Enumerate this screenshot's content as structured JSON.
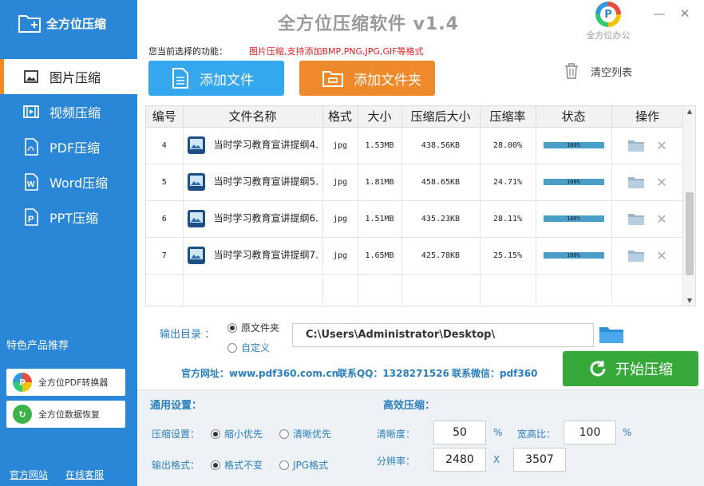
{
  "app": {
    "logo_text": "全方位压缩",
    "title": "全方位压缩软件 v1.4",
    "brand_text": "全方位办公",
    "brand_letter": "P"
  },
  "sidebar": {
    "items": [
      {
        "label": "图片压缩",
        "icon": "image-icon"
      },
      {
        "label": "视频压缩",
        "icon": "film-icon"
      },
      {
        "label": "PDF压缩",
        "icon": "pdf-icon"
      },
      {
        "label": "Word压缩",
        "icon": "word-icon"
      },
      {
        "label": "PPT压缩",
        "icon": "ppt-icon"
      }
    ],
    "promo_title": "特色产品推荐",
    "promo_buttons": [
      "全方位PDF转换器",
      "全方位数据恢复"
    ],
    "links": [
      "官方网站",
      "在线客服"
    ]
  },
  "toolbar": {
    "func_label": "您当前选择的功能：",
    "func_value": "图片压缩,支持添加BMP,PNG,JPG,GIF等格式",
    "add_file": "添加文件",
    "add_folder": "添加文件夹",
    "clear_list": "清空列表"
  },
  "table": {
    "headers": [
      "编号",
      "文件名称",
      "格式",
      "大小",
      "压缩后大小",
      "压缩率",
      "状态",
      "操作"
    ],
    "rows": [
      {
        "id": "4",
        "name": "当时学习教育宣讲提纲4.",
        "format": "jpg",
        "size": "1.53MB",
        "compressed": "438.56KB",
        "ratio": "28.00%",
        "progress": "100%"
      },
      {
        "id": "5",
        "name": "当时学习教育宣讲提纲5.",
        "format": "jpg",
        "size": "1.81MB",
        "compressed": "458.65KB",
        "ratio": "24.71%",
        "progress": "100%"
      },
      {
        "id": "6",
        "name": "当时学习教育宣讲提纲6.",
        "format": "jpg",
        "size": "1.51MB",
        "compressed": "435.23KB",
        "ratio": "28.11%",
        "progress": "100%"
      },
      {
        "id": "7",
        "name": "当时学习教育宣讲提纲7.",
        "format": "jpg",
        "size": "1.65MB",
        "compressed": "425.78KB",
        "ratio": "25.15%",
        "progress": "100%"
      }
    ]
  },
  "output": {
    "label": "输出目录 ：",
    "option_original": "原文件夹",
    "option_custom": "自定义",
    "path": "C:\\Users\\Administrator\\Desktop\\"
  },
  "contact": {
    "website": "官方网址：www.pdf360.com.cn",
    "qq": "联系QQ：1328271526",
    "wechat": "联系微信：pdf360"
  },
  "start_button": "开始压缩",
  "settings": {
    "general_title": "通用设置：",
    "compress_label": "压缩设置：",
    "compress_small": "缩小优先",
    "compress_clear": "清晰优先",
    "format_label": "输出格式：",
    "format_keep": "格式不变",
    "format_jpg": "JPG格式",
    "efficient_title": "高效压缩：",
    "clarity_label": "清晰度：",
    "clarity_value": "50",
    "percent": "%",
    "aspect_label": "宽高比：",
    "aspect_value": "100",
    "resolution_label": "分辨率：",
    "res_width": "2480",
    "res_x": "X",
    "res_height": "3507"
  }
}
